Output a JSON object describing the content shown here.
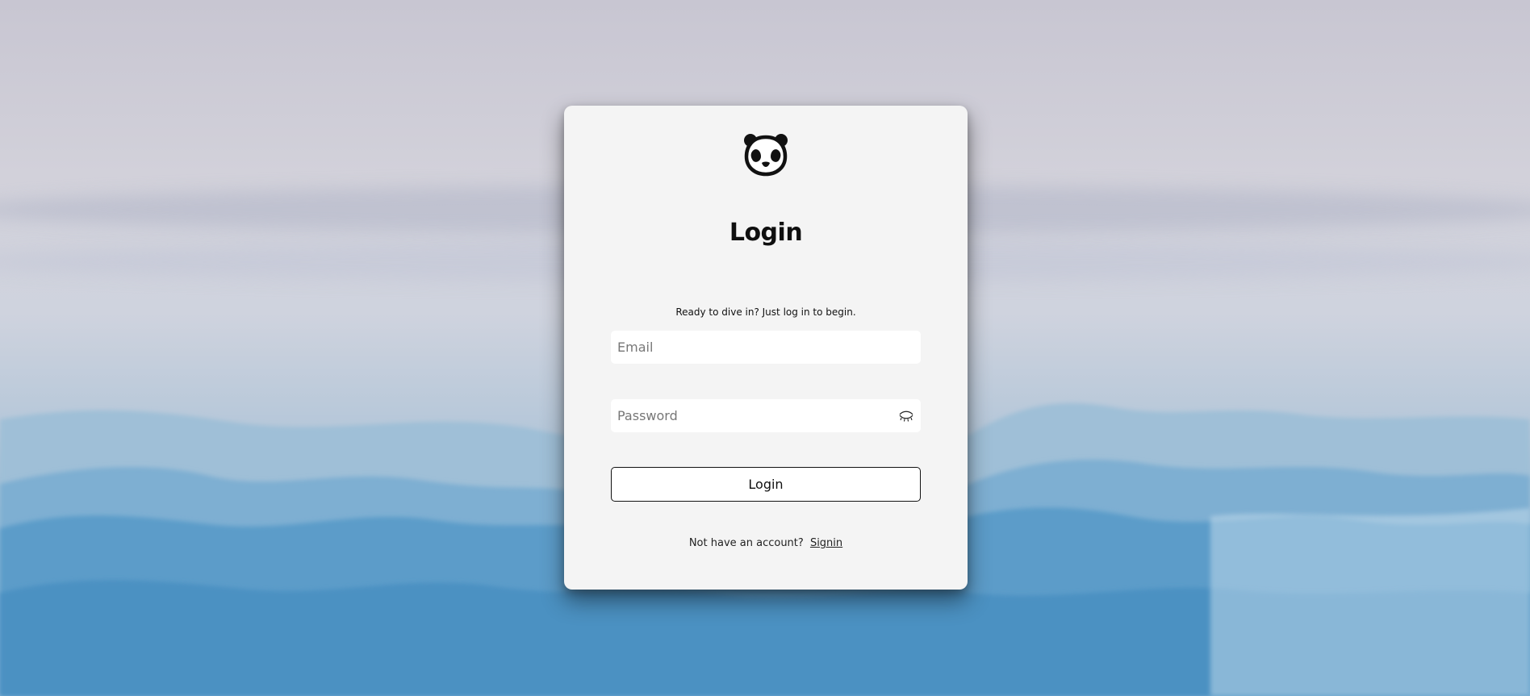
{
  "theme": {
    "card_background": "#f4f4f4",
    "text_color": "#111111",
    "sky_top": "#c8c6d2",
    "mountain_blue": "#4a90bf"
  },
  "logo": {
    "icon": "panda-icon"
  },
  "login_form": {
    "title": "Login",
    "subtitle": "Ready to dive in? Just log in to begin.",
    "email_placeholder": "Email",
    "email_value": "",
    "password_placeholder": "Password",
    "password_value": "",
    "password_toggle_icon": "eye-closed-icon",
    "submit_label": "Login"
  },
  "signup": {
    "prompt": "Not have an account?",
    "link_label": "Signin"
  }
}
